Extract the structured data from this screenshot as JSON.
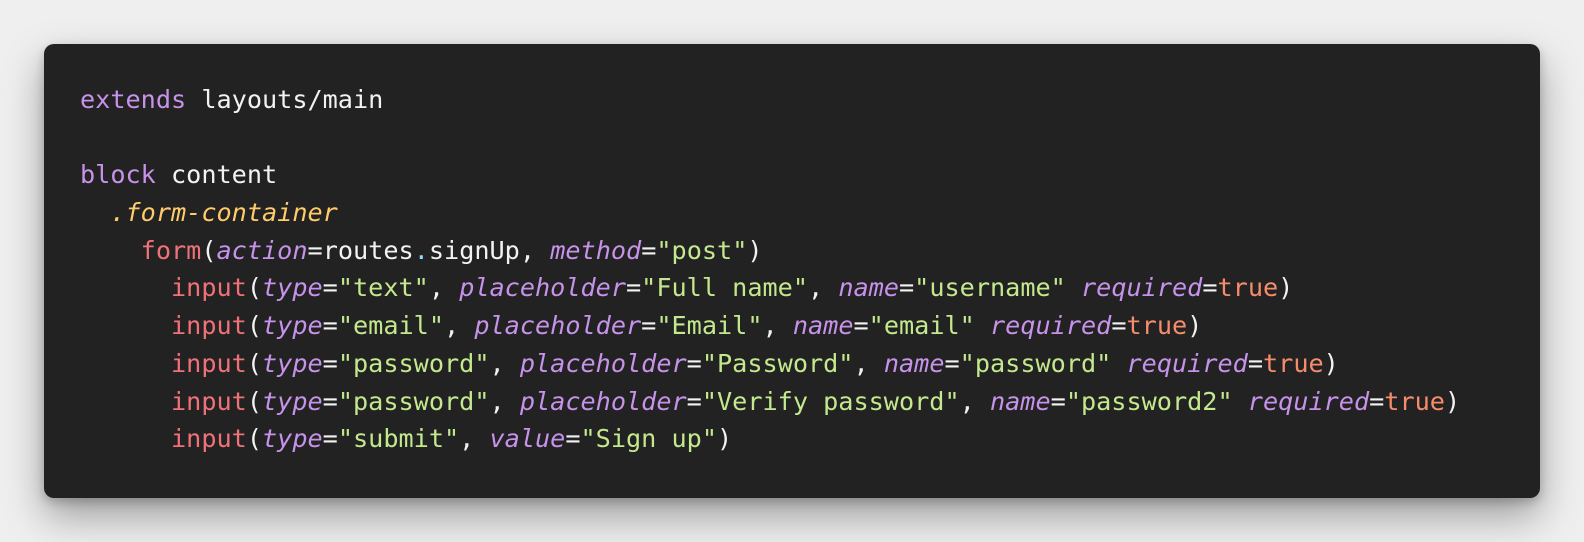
{
  "code": {
    "lines": [
      {
        "indent": "",
        "tokens": [
          {
            "t": "extends",
            "c": "kw"
          },
          {
            "t": " ",
            "c": "plain"
          },
          {
            "t": "layouts/main",
            "c": "plain"
          }
        ]
      },
      {
        "indent": "",
        "tokens": []
      },
      {
        "indent": "",
        "tokens": [
          {
            "t": "block",
            "c": "kw"
          },
          {
            "t": " ",
            "c": "plain"
          },
          {
            "t": "content",
            "c": "plain"
          }
        ]
      },
      {
        "indent": "  ",
        "tokens": [
          {
            "t": ".form-container",
            "c": "cls"
          }
        ]
      },
      {
        "indent": "    ",
        "tokens": [
          {
            "t": "form",
            "c": "tag"
          },
          {
            "t": "(",
            "c": "plain"
          },
          {
            "t": "action",
            "c": "attr"
          },
          {
            "t": "=",
            "c": "plain"
          },
          {
            "t": "routes",
            "c": "plain"
          },
          {
            "t": ".",
            "c": "dot"
          },
          {
            "t": "signUp",
            "c": "plain"
          },
          {
            "t": ", ",
            "c": "plain"
          },
          {
            "t": "method",
            "c": "attr"
          },
          {
            "t": "=",
            "c": "plain"
          },
          {
            "t": "\"post\"",
            "c": "str"
          },
          {
            "t": ")",
            "c": "plain"
          }
        ]
      },
      {
        "indent": "      ",
        "tokens": [
          {
            "t": "input",
            "c": "tag"
          },
          {
            "t": "(",
            "c": "plain"
          },
          {
            "t": "type",
            "c": "attr"
          },
          {
            "t": "=",
            "c": "plain"
          },
          {
            "t": "\"text\"",
            "c": "str"
          },
          {
            "t": ", ",
            "c": "plain"
          },
          {
            "t": "placeholder",
            "c": "attr"
          },
          {
            "t": "=",
            "c": "plain"
          },
          {
            "t": "\"Full name\"",
            "c": "str"
          },
          {
            "t": ", ",
            "c": "plain"
          },
          {
            "t": "name",
            "c": "attr"
          },
          {
            "t": "=",
            "c": "plain"
          },
          {
            "t": "\"username\"",
            "c": "str"
          },
          {
            "t": " ",
            "c": "plain"
          },
          {
            "t": "required",
            "c": "attr"
          },
          {
            "t": "=",
            "c": "plain"
          },
          {
            "t": "true",
            "c": "bool"
          },
          {
            "t": ")",
            "c": "plain"
          }
        ]
      },
      {
        "indent": "      ",
        "tokens": [
          {
            "t": "input",
            "c": "tag"
          },
          {
            "t": "(",
            "c": "plain"
          },
          {
            "t": "type",
            "c": "attr"
          },
          {
            "t": "=",
            "c": "plain"
          },
          {
            "t": "\"email\"",
            "c": "str"
          },
          {
            "t": ", ",
            "c": "plain"
          },
          {
            "t": "placeholder",
            "c": "attr"
          },
          {
            "t": "=",
            "c": "plain"
          },
          {
            "t": "\"Email\"",
            "c": "str"
          },
          {
            "t": ", ",
            "c": "plain"
          },
          {
            "t": "name",
            "c": "attr"
          },
          {
            "t": "=",
            "c": "plain"
          },
          {
            "t": "\"email\"",
            "c": "str"
          },
          {
            "t": " ",
            "c": "plain"
          },
          {
            "t": "required",
            "c": "attr"
          },
          {
            "t": "=",
            "c": "plain"
          },
          {
            "t": "true",
            "c": "bool"
          },
          {
            "t": ")",
            "c": "plain"
          }
        ]
      },
      {
        "indent": "      ",
        "tokens": [
          {
            "t": "input",
            "c": "tag"
          },
          {
            "t": "(",
            "c": "plain"
          },
          {
            "t": "type",
            "c": "attr"
          },
          {
            "t": "=",
            "c": "plain"
          },
          {
            "t": "\"password\"",
            "c": "str"
          },
          {
            "t": ", ",
            "c": "plain"
          },
          {
            "t": "placeholder",
            "c": "attr"
          },
          {
            "t": "=",
            "c": "plain"
          },
          {
            "t": "\"Password\"",
            "c": "str"
          },
          {
            "t": ", ",
            "c": "plain"
          },
          {
            "t": "name",
            "c": "attr"
          },
          {
            "t": "=",
            "c": "plain"
          },
          {
            "t": "\"password\"",
            "c": "str"
          },
          {
            "t": " ",
            "c": "plain"
          },
          {
            "t": "required",
            "c": "attr"
          },
          {
            "t": "=",
            "c": "plain"
          },
          {
            "t": "true",
            "c": "bool"
          },
          {
            "t": ")",
            "c": "plain"
          }
        ]
      },
      {
        "indent": "      ",
        "tokens": [
          {
            "t": "input",
            "c": "tag"
          },
          {
            "t": "(",
            "c": "plain"
          },
          {
            "t": "type",
            "c": "attr"
          },
          {
            "t": "=",
            "c": "plain"
          },
          {
            "t": "\"password\"",
            "c": "str"
          },
          {
            "t": ", ",
            "c": "plain"
          },
          {
            "t": "placeholder",
            "c": "attr"
          },
          {
            "t": "=",
            "c": "plain"
          },
          {
            "t": "\"Verify password\"",
            "c": "str"
          },
          {
            "t": ", ",
            "c": "plain"
          },
          {
            "t": "name",
            "c": "attr"
          },
          {
            "t": "=",
            "c": "plain"
          },
          {
            "t": "\"password2\"",
            "c": "str"
          },
          {
            "t": " ",
            "c": "plain"
          },
          {
            "t": "required",
            "c": "attr"
          },
          {
            "t": "=",
            "c": "plain"
          },
          {
            "t": "true",
            "c": "bool"
          },
          {
            "t": ")",
            "c": "plain"
          }
        ]
      },
      {
        "indent": "      ",
        "tokens": [
          {
            "t": "input",
            "c": "tag"
          },
          {
            "t": "(",
            "c": "plain"
          },
          {
            "t": "type",
            "c": "attr"
          },
          {
            "t": "=",
            "c": "plain"
          },
          {
            "t": "\"submit\"",
            "c": "str"
          },
          {
            "t": ", ",
            "c": "plain"
          },
          {
            "t": "value",
            "c": "attr"
          },
          {
            "t": "=",
            "c": "plain"
          },
          {
            "t": "\"Sign up\"",
            "c": "str"
          },
          {
            "t": ")",
            "c": "plain"
          }
        ]
      }
    ]
  },
  "colors": {
    "background": "#efefef",
    "panel": "#222222",
    "keyword": "#c792ea",
    "class": "#ffcb6b",
    "tag": "#f07178",
    "string": "#c3e88d",
    "boolean": "#f78c6c",
    "punctuation": "#89ddff",
    "text": "#f2f2f2"
  }
}
